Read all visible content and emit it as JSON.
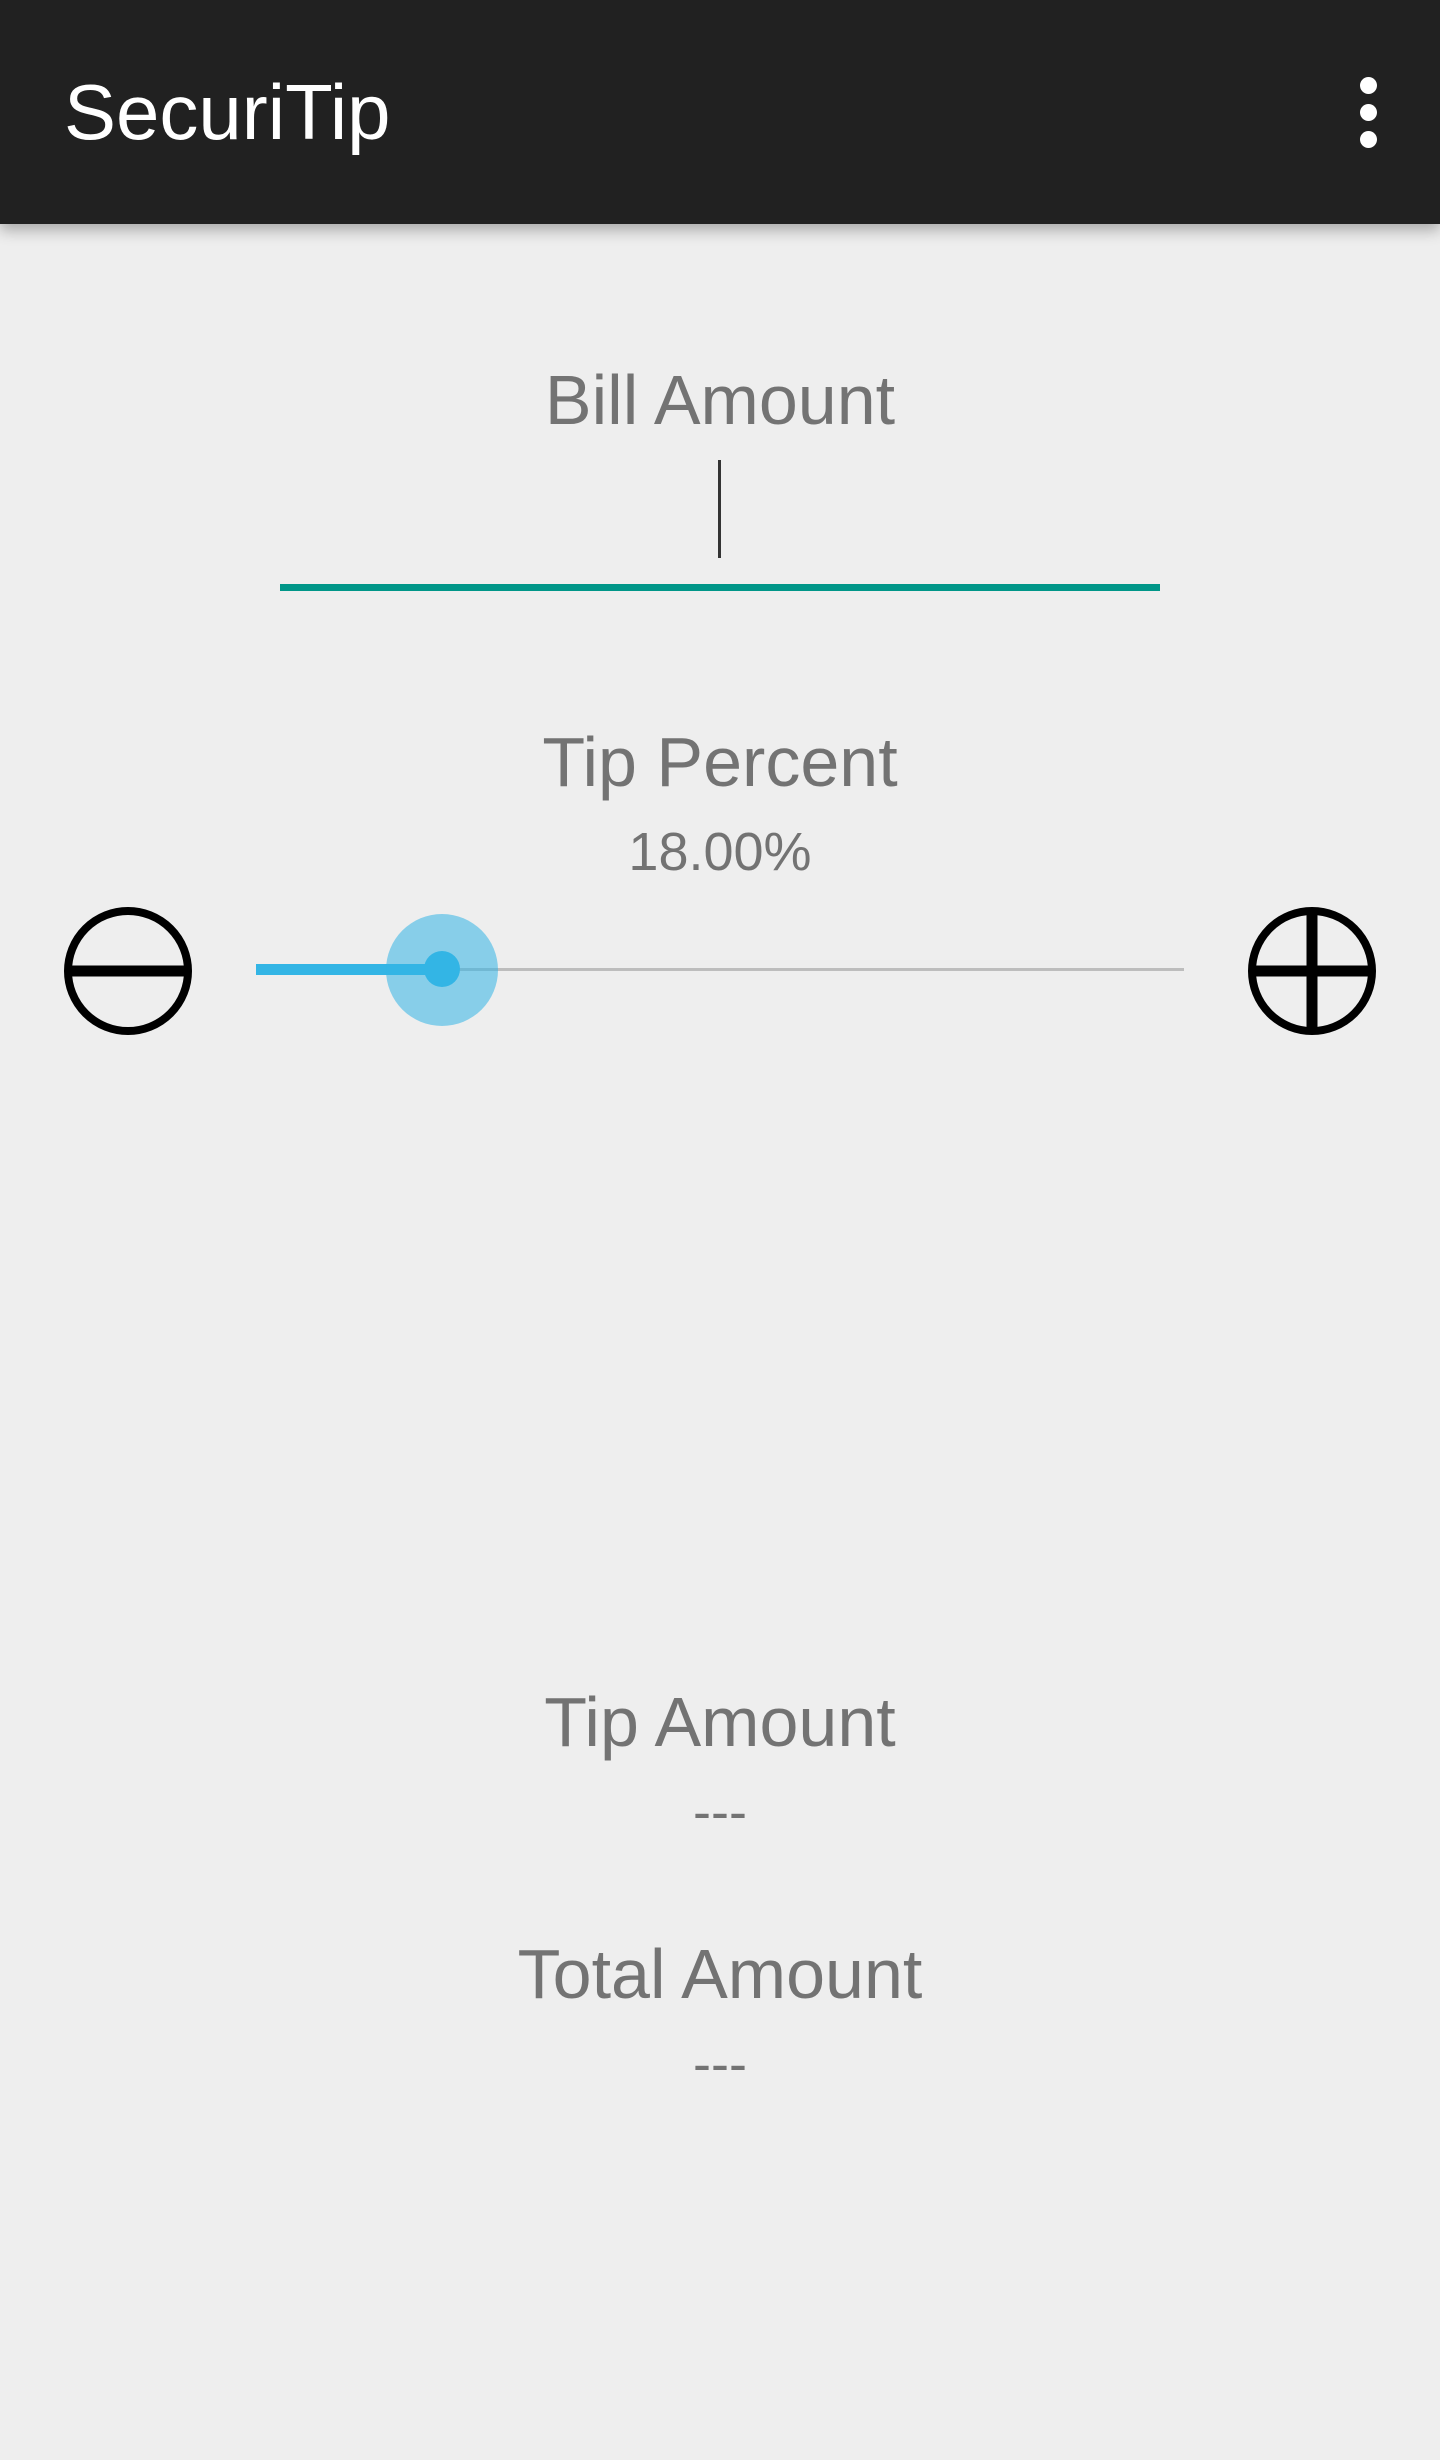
{
  "app_bar": {
    "title": "SecuriTip",
    "overflow_icon": "more-vert-icon"
  },
  "bill": {
    "label": "Bill Amount",
    "value": "",
    "accent_color": "#009688"
  },
  "tip_percent": {
    "label": "Tip Percent",
    "value_text": "18.00%",
    "slider_fraction": 0.2,
    "accent_color": "#33b5e5",
    "decrease_icon": "minus-circle-icon",
    "increase_icon": "plus-circle-icon"
  },
  "tip_amount": {
    "label": "Tip Amount",
    "value": "---"
  },
  "total_amount": {
    "label": "Total Amount",
    "value": "---"
  }
}
